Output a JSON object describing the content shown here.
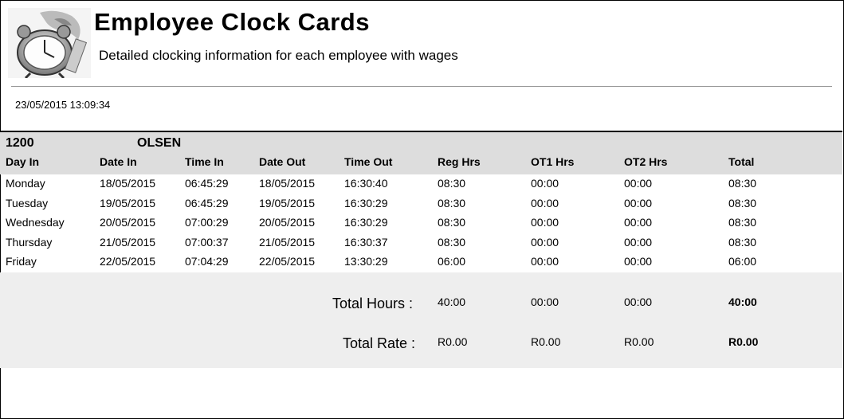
{
  "report": {
    "title": "Employee Clock Cards",
    "subtitle": "Detailed clocking information for each employee with wages",
    "printed_at": "23/05/2015 13:09:34"
  },
  "employee": {
    "code": "1200",
    "name": "OLSEN"
  },
  "columns": [
    "Day In",
    "Date In",
    "Time In",
    "Date Out",
    "Time Out",
    "Reg Hrs",
    "OT1 Hrs",
    "OT2 Hrs",
    "Total"
  ],
  "rows": [
    [
      "Monday",
      "18/05/2015",
      "06:45:29",
      "18/05/2015",
      "16:30:40",
      "08:30",
      "00:00",
      "00:00",
      "08:30"
    ],
    [
      "Tuesday",
      "19/05/2015",
      "06:45:29",
      "19/05/2015",
      "16:30:29",
      "08:30",
      "00:00",
      "00:00",
      "08:30"
    ],
    [
      "Wednesday",
      "20/05/2015",
      "07:00:29",
      "20/05/2015",
      "16:30:29",
      "08:30",
      "00:00",
      "00:00",
      "08:30"
    ],
    [
      "Thursday",
      "21/05/2015",
      "07:00:37",
      "21/05/2015",
      "16:30:37",
      "08:30",
      "00:00",
      "00:00",
      "08:30"
    ],
    [
      "Friday",
      "22/05/2015",
      "07:04:29",
      "22/05/2015",
      "13:30:29",
      "06:00",
      "00:00",
      "00:00",
      "06:00"
    ]
  ],
  "totals": {
    "hours_label": "Total Hours :",
    "hours": {
      "reg": "40:00",
      "ot1": "00:00",
      "ot2": "00:00",
      "total": "40:00"
    },
    "rate_label": "Total Rate :",
    "rate": {
      "reg": "R0.00",
      "ot1": "R0.00",
      "ot2": "R0.00",
      "total": "R0.00"
    }
  },
  "icons": {
    "logo": "alarm-clock-logo-icon"
  }
}
